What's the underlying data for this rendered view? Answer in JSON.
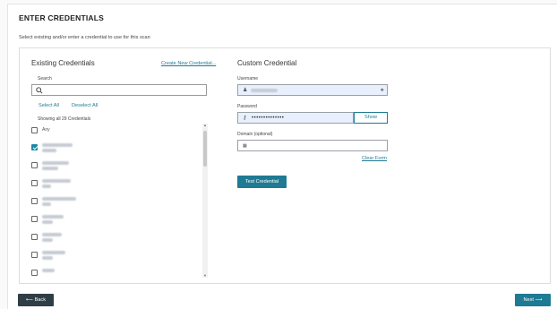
{
  "page": {
    "title": "ENTER CREDENTIALS",
    "subtitle": "Select existing and/or enter a credential to use for this scan"
  },
  "existing": {
    "heading": "Existing Credentials",
    "create_link": "Create New Credential...",
    "search_label": "Search",
    "search_value": "",
    "select_all": "Select All",
    "deselect_all": "Deselect All",
    "count_text": "Showing all 29 Credentials",
    "items": [
      {
        "label": "Any",
        "checked": false,
        "blurred": false
      },
      {
        "label": "",
        "checked": true,
        "blurred": true
      },
      {
        "label": "",
        "checked": false,
        "blurred": true
      },
      {
        "label": "",
        "checked": false,
        "blurred": true
      },
      {
        "label": "",
        "checked": false,
        "blurred": true
      },
      {
        "label": "",
        "checked": false,
        "blurred": true
      },
      {
        "label": "",
        "checked": false,
        "blurred": true
      },
      {
        "label": "",
        "checked": false,
        "blurred": true
      },
      {
        "label": "",
        "checked": false,
        "blurred": true
      }
    ]
  },
  "custom": {
    "heading": "Custom Credential",
    "username_label": "Username",
    "password_label": "Password",
    "password_mask": "••••••••••••••",
    "show_label": "Show",
    "domain_label": "Domain (optional)",
    "clear_label": "Clear Form",
    "test_label": "Test Credential"
  },
  "footer": {
    "back_label": "Back",
    "next_label": "Next"
  },
  "icons": {
    "search": "search-icon",
    "user": "user-icon",
    "key": "key-icon",
    "domain": "domain-icon",
    "back": "arrow-left-icon",
    "next": "arrow-right-icon"
  },
  "colors": {
    "accent": "#1f7a93",
    "dark_button": "#2f3e46",
    "checked": "#1e87a6",
    "filled_field": "#e8f0fe"
  }
}
